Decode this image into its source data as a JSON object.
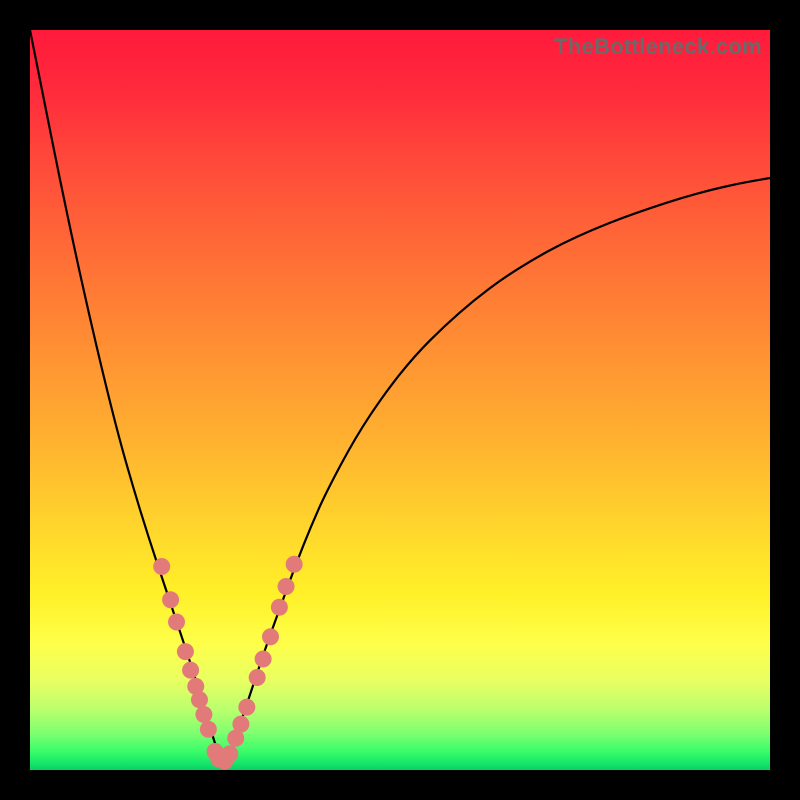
{
  "watermark": "TheBottleneck.com",
  "colors": {
    "frame": "#000000",
    "curve": "#000000",
    "dot_fill": "#e27a7a",
    "gradient_stops": [
      "#ff1a3c",
      "#ff2a3c",
      "#ff4a3a",
      "#ff7a35",
      "#ffb030",
      "#ffd82c",
      "#fff028",
      "#feff4a",
      "#e8ff62",
      "#b8ff6e",
      "#7eff70",
      "#3afc6a",
      "#16e869",
      "#0fce68"
    ]
  },
  "chart_data": {
    "type": "line",
    "title": "",
    "xlabel": "",
    "ylabel": "",
    "xlim": [
      0,
      100
    ],
    "ylim": [
      0,
      100
    ],
    "minimum_at_x": 26,
    "series": [
      {
        "name": "bottleneck-curve",
        "x": [
          0,
          2,
          4,
          6,
          8,
          10,
          12,
          14,
          16,
          18,
          20,
          22,
          24,
          25,
          26,
          27,
          28,
          30,
          32,
          34,
          36,
          38,
          40,
          44,
          48,
          52,
          56,
          60,
          64,
          68,
          72,
          76,
          80,
          84,
          88,
          92,
          96,
          100
        ],
        "y": [
          100,
          90,
          80,
          70.5,
          61.5,
          53,
          45,
          38,
          31.5,
          25.5,
          19.5,
          13.5,
          7,
          3.5,
          1,
          2,
          5,
          11,
          17,
          22.5,
          28,
          33,
          37.5,
          45,
          51,
          56,
          60,
          63.5,
          66.5,
          69,
          71.2,
          73,
          74.6,
          76,
          77.3,
          78.4,
          79.3,
          80
        ]
      }
    ],
    "markers": [
      {
        "x": 17.8,
        "y": 27.5
      },
      {
        "x": 19.0,
        "y": 23.0
      },
      {
        "x": 19.8,
        "y": 20.0
      },
      {
        "x": 21.0,
        "y": 16.0
      },
      {
        "x": 21.7,
        "y": 13.5
      },
      {
        "x": 22.4,
        "y": 11.3
      },
      {
        "x": 22.9,
        "y": 9.5
      },
      {
        "x": 23.5,
        "y": 7.5
      },
      {
        "x": 24.1,
        "y": 5.5
      },
      {
        "x": 25.0,
        "y": 2.5
      },
      {
        "x": 25.5,
        "y": 1.5
      },
      {
        "x": 26.3,
        "y": 1.2
      },
      {
        "x": 27.0,
        "y": 2.2
      },
      {
        "x": 27.8,
        "y": 4.3
      },
      {
        "x": 28.5,
        "y": 6.2
      },
      {
        "x": 29.3,
        "y": 8.5
      },
      {
        "x": 30.7,
        "y": 12.5
      },
      {
        "x": 31.5,
        "y": 15.0
      },
      {
        "x": 32.5,
        "y": 18.0
      },
      {
        "x": 33.7,
        "y": 22.0
      },
      {
        "x": 34.6,
        "y": 24.8
      },
      {
        "x": 35.7,
        "y": 27.8
      }
    ]
  }
}
